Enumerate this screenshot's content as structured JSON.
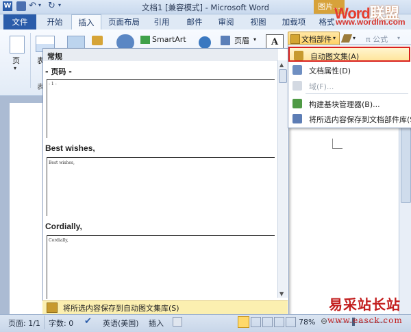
{
  "window": {
    "title": "文档1 [兼容模式] - Microsoft Word",
    "picture_tools_tab": "图片..."
  },
  "watermark": {
    "logo_part1": "Word",
    "logo_part2": "联盟",
    "url": "www.wordlm.com",
    "site_name": "易采站长站",
    "site_url": "www.easck.com"
  },
  "tabs": {
    "file": "文件",
    "items": [
      "开始",
      "插入",
      "页面布局",
      "引用",
      "邮件",
      "审阅",
      "视图",
      "加载项",
      "格式"
    ]
  },
  "ribbon": {
    "pages_label": "页",
    "table_label": "表",
    "smartart_label": "SmartArt",
    "header_label": "页眉",
    "quick_parts_label": "文档部件",
    "equation_label": "π 公式"
  },
  "gallery": {
    "section_header": "常规",
    "subheader": "- 页码 -",
    "entries": [
      {
        "title": "",
        "preview": "- 1 -"
      },
      {
        "title": "Best wishes,",
        "preview": "Best wishes,"
      },
      {
        "title": "Cordially,",
        "preview": "Cordially,"
      }
    ],
    "footer": "将所选内容保存到自动图文集库(S)"
  },
  "quick_parts_menu": {
    "items": [
      {
        "label": "自动图文集(A)",
        "highlighted": true,
        "enabled": true
      },
      {
        "label": "文档属性(D)",
        "highlighted": false,
        "enabled": true
      },
      {
        "label": "域(F)...",
        "highlighted": false,
        "enabled": false
      },
      {
        "label": "构建基块管理器(B)...",
        "highlighted": false,
        "enabled": true
      },
      {
        "label": "将所选内容保存到文档部件库(S)",
        "highlighted": false,
        "enabled": true
      }
    ]
  },
  "statusbar": {
    "page": "页面: 1/1",
    "words": "字数: 0",
    "language": "英语(美国)",
    "mode": "插入",
    "zoom": "78%"
  },
  "colors": {
    "accent": "#2a5caa",
    "highlight_border": "#d9201d",
    "menu_hover": "#ffe59c"
  }
}
